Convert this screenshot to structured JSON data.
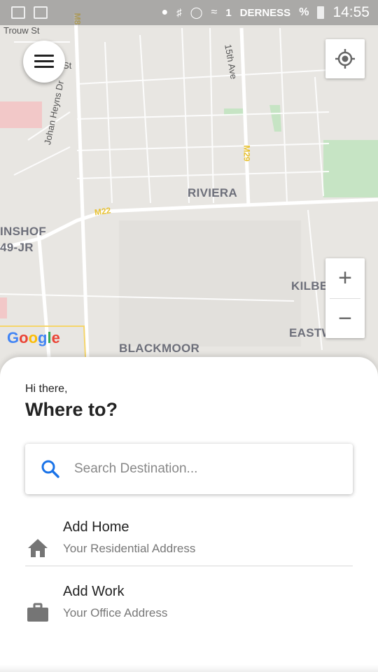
{
  "status_bar": {
    "sim_number": "1",
    "carrier_overlay": "DERNESS",
    "battery_pct": "%",
    "time": "14:55"
  },
  "map": {
    "labels": {
      "riviera": "RIVIERA",
      "inshof": "INSHOF",
      "jr": "49-JR",
      "kilberry": "KILBERRY",
      "eastwood": "EASTWOOD",
      "blackmoor": "BLACKMOOR"
    },
    "streets": {
      "trouw": "Trouw St",
      "st": "St",
      "johan": "Johan Heyns Dr",
      "fifteenth": "15th Ave"
    },
    "roads": {
      "m22": "M22",
      "m29": "M29",
      "m8": "M8"
    },
    "attribution": "Google",
    "zoom_in": "+",
    "zoom_out": "−"
  },
  "sheet": {
    "greeting": "Hi there,",
    "heading": "Where to?",
    "search": {
      "placeholder": "Search Destination..."
    },
    "items": [
      {
        "title": "Add Home",
        "subtitle": "Your Residential Address",
        "icon": "home-icon"
      },
      {
        "title": "Add Work",
        "subtitle": "Your Office Address",
        "icon": "briefcase-icon"
      }
    ]
  },
  "colors": {
    "accent": "#1a73e8",
    "map_bg": "#e6e4e0",
    "park": "#c8e6c9"
  }
}
